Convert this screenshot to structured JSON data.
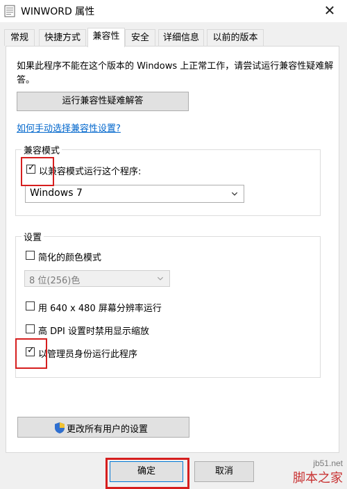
{
  "window": {
    "title": "WINWORD 属性"
  },
  "tabs": [
    {
      "label": "常规"
    },
    {
      "label": "快捷方式"
    },
    {
      "label": "兼容性"
    },
    {
      "label": "安全"
    },
    {
      "label": "详细信息"
    },
    {
      "label": "以前的版本"
    }
  ],
  "compat": {
    "description": "如果此程序不能在这个版本的 Windows 上正常工作，请尝试运行兼容性疑难解答。",
    "troubleshoot_button": "运行兼容性疑难解答",
    "manual_link": "如何手动选择兼容性设置?",
    "mode_group_title": "兼容模式",
    "mode_checkbox_label": "以兼容模式运行这个程序:",
    "mode_checked": true,
    "os_select_value": "Windows 7"
  },
  "settings": {
    "group_title": "设置",
    "reduced_color_label": "简化的颜色模式",
    "reduced_color_checked": false,
    "color_select_value": "8 位(256)色",
    "resolution_label": "用 640 x 480 屏幕分辨率运行",
    "resolution_checked": false,
    "dpi_label": "高 DPI 设置时禁用显示缩放",
    "dpi_checked": false,
    "admin_label": "以管理员身份运行此程序",
    "admin_checked": true
  },
  "all_users_button": "更改所有用户的设置",
  "footer": {
    "ok_button": "确定",
    "cancel_button": "取消"
  },
  "watermark": {
    "url": "jb51.net",
    "name": "脚本之家"
  },
  "colors": {
    "highlight_box": "#d61e1e",
    "link": "#0066cc"
  }
}
